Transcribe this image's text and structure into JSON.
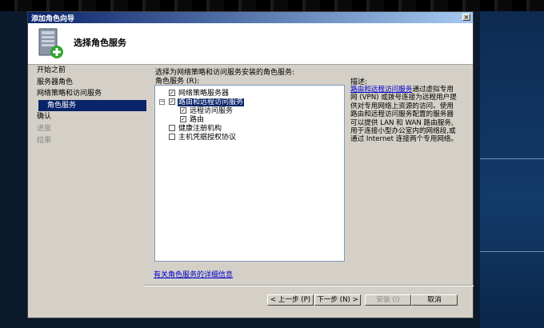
{
  "window": {
    "title": "添加角色向导",
    "close_glyph": "×"
  },
  "header": {
    "title": "选择角色服务"
  },
  "nav": [
    {
      "label": "开始之前",
      "state": "normal"
    },
    {
      "label": "服务器角色",
      "state": "normal"
    },
    {
      "label": "网络策略和访问服务",
      "state": "normal"
    },
    {
      "label": "角色服务",
      "state": "active"
    },
    {
      "label": "确认",
      "state": "normal"
    },
    {
      "label": "进度",
      "state": "disabled"
    },
    {
      "label": "结果",
      "state": "disabled"
    }
  ],
  "main": {
    "instruction": "选择为网络策略和访问服务安装的角色服务:",
    "roles_label": "角色服务 (R):",
    "tree": [
      {
        "label": "网络策略服务器",
        "checked": true,
        "level": 0,
        "expander": "",
        "selected": false
      },
      {
        "label": "路由和远程访问服务",
        "checked": true,
        "level": 0,
        "expander": "−",
        "selected": true
      },
      {
        "label": "远程访问服务",
        "checked": true,
        "level": 1,
        "expander": "",
        "selected": false
      },
      {
        "label": "路由",
        "checked": true,
        "level": 1,
        "expander": "",
        "selected": false
      },
      {
        "label": "健康注册机构",
        "checked": false,
        "level": 0,
        "expander": "",
        "selected": false
      },
      {
        "label": "主机凭据授权协议",
        "checked": false,
        "level": 0,
        "expander": "",
        "selected": false
      }
    ],
    "details_link": "有关角色服务的详细信息"
  },
  "description": {
    "heading": "描述:",
    "link_text": "路由和远程访问服务",
    "body": "通过虚拟专用网 (VPN) 或拨号连接为远程用户提供对专用网络上资源的访问。使用路由和远程访问服务配置的服务器可以提供 LAN 和 WAN 路由服务,用于连接小型办公室内的网络段,或通过 Internet 连接两个专用网络。"
  },
  "buttons": {
    "back": "< 上一步 (P)",
    "next": "下一步 (N) >",
    "install": "安装 (I)",
    "cancel": "取消"
  }
}
